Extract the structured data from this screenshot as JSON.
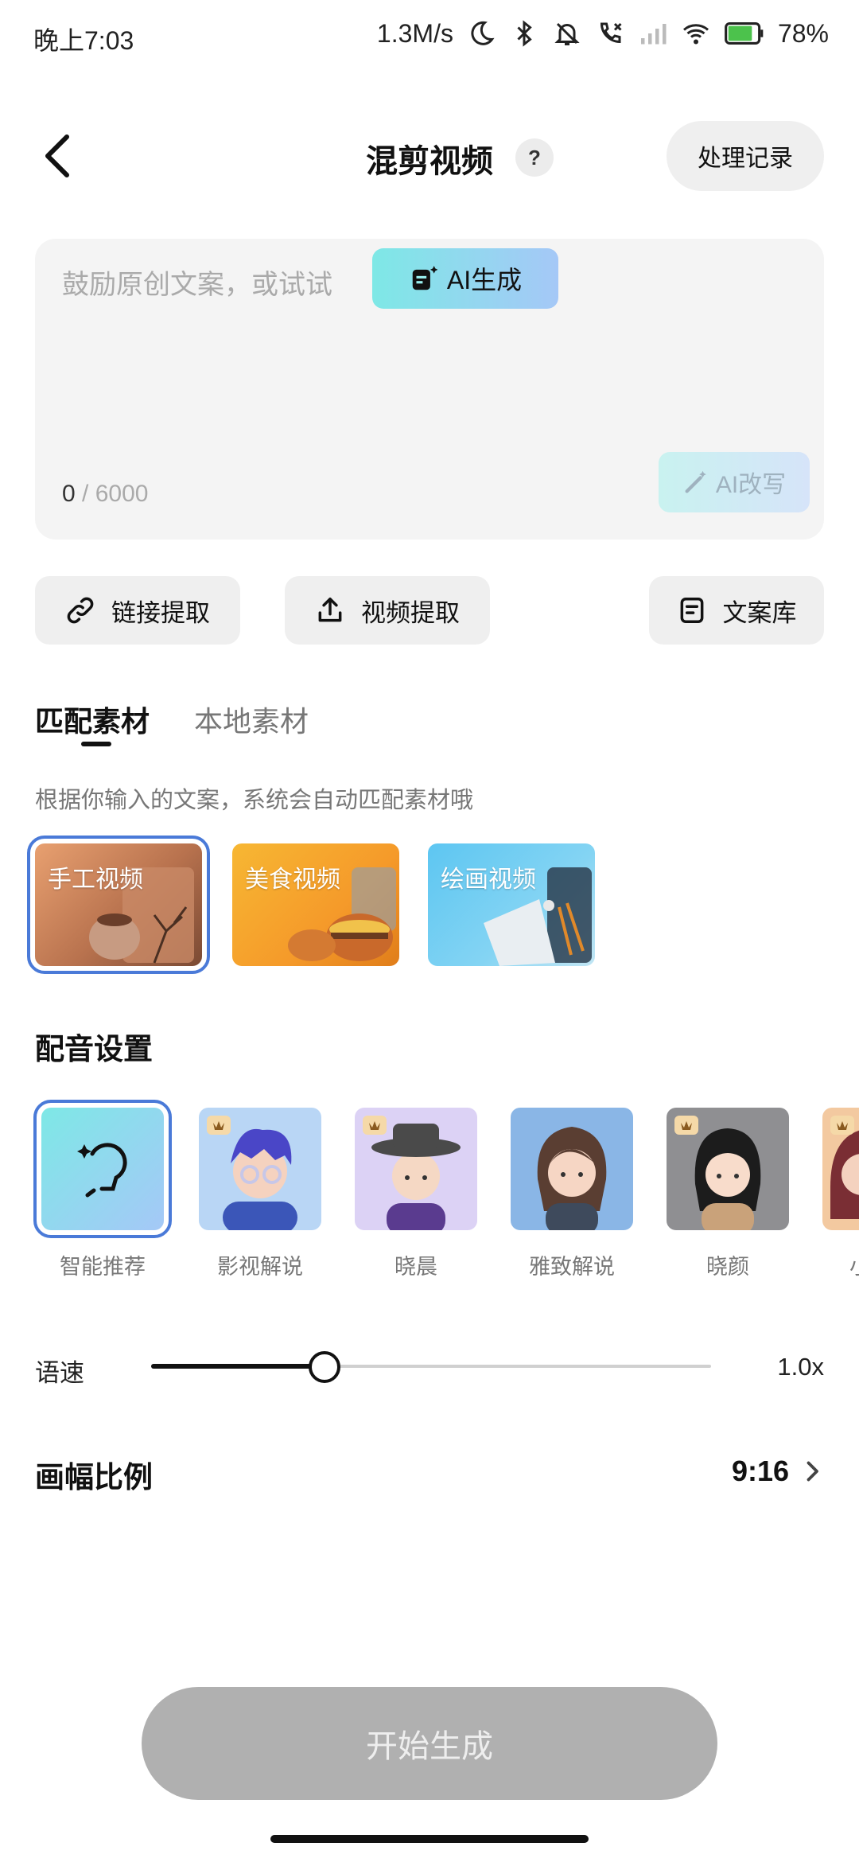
{
  "status_bar": {
    "time": "晚上7:03",
    "net_speed": "1.3M/s",
    "battery": "78%"
  },
  "header": {
    "title": "混剪视频",
    "help": "?",
    "records_label": "处理记录"
  },
  "editor": {
    "placeholder": "鼓励原创文案，或试试",
    "ai_generate": "AI生成",
    "char_count": "0",
    "char_limit": "/ 6000",
    "ai_rewrite": "AI改写"
  },
  "actions": {
    "link_extract": "链接提取",
    "video_extract": "视频提取",
    "copy_library": "文案库"
  },
  "material_tabs": {
    "matched": "匹配素材",
    "local": "本地素材"
  },
  "material_hint": "根据你输入的文案，系统会自动匹配素材哦",
  "materials": [
    {
      "label": "手工视频",
      "selected": true
    },
    {
      "label": "美食视频",
      "selected": false
    },
    {
      "label": "绘画视频",
      "selected": false
    }
  ],
  "voice_section": "配音设置",
  "voices": [
    {
      "name": "智能推荐",
      "selected": true
    },
    {
      "name": "影视解说",
      "selected": false
    },
    {
      "name": "晓晨",
      "selected": false
    },
    {
      "name": "雅致解说",
      "selected": false
    },
    {
      "name": "晓颜",
      "selected": false
    },
    {
      "name": "小",
      "selected": false
    }
  ],
  "speed": {
    "label": "语速",
    "value": "1.0x",
    "slider_fraction": 0.31
  },
  "ratio": {
    "label": "画幅比例",
    "value": "9:16"
  },
  "start_button": "开始生成",
  "colors": {
    "accent_outline": "#4a7ad8",
    "ai_gradient_start": "#7ee8e6",
    "ai_gradient_end": "#a5c8f7",
    "start_disabled": "#b0b0b0"
  }
}
